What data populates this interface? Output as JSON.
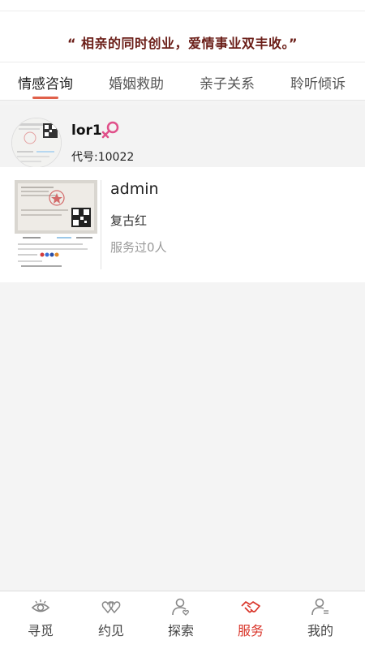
{
  "slogan": "“ 相亲的同时创业，爱情事业双丰收。”",
  "tabs": [
    {
      "label": "情感咨询",
      "active": true
    },
    {
      "label": "婚姻救助",
      "active": false
    },
    {
      "label": "亲子关系",
      "active": false
    },
    {
      "label": "聆听倾诉",
      "active": false
    }
  ],
  "profile": {
    "name": "lor1",
    "gender_icon": "female-icon",
    "code": "代号:10022"
  },
  "card": {
    "name": "admin",
    "tag": "复古红",
    "served": "服务过0人"
  },
  "bottom_nav": [
    {
      "label": "寻觅",
      "icon": "eye-icon",
      "active": false
    },
    {
      "label": "约见",
      "icon": "hearts-icon",
      "active": false
    },
    {
      "label": "探索",
      "icon": "user-heart-icon",
      "active": false
    },
    {
      "label": "服务",
      "icon": "handshake-icon",
      "active": true
    },
    {
      "label": "我的",
      "icon": "user-profile-icon",
      "active": false
    }
  ],
  "colors": {
    "slogan": "#6b1e18",
    "accent": "#e0604a",
    "active_nav": "#d9352a",
    "female": "#e0508a"
  }
}
